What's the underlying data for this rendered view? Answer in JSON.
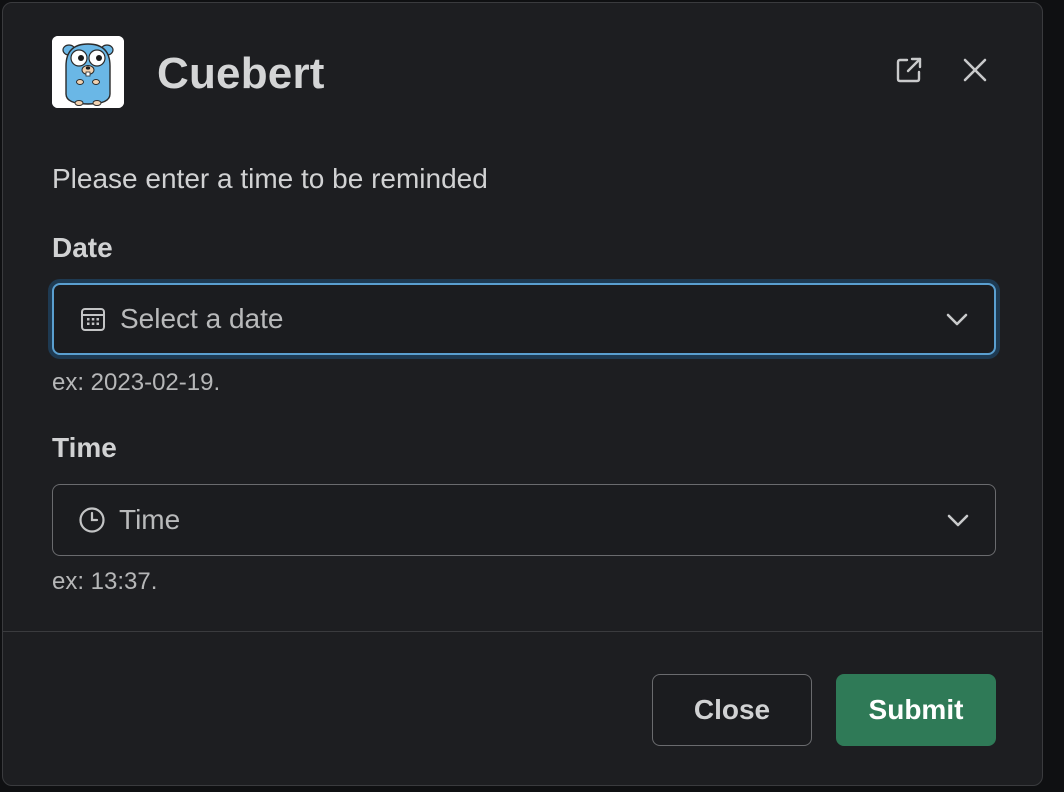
{
  "modal": {
    "title": "Cuebert",
    "app_icon": "gopher-mascot-icon",
    "header_actions": [
      {
        "icon": "open-in-new-window-icon"
      },
      {
        "icon": "close-icon"
      }
    ]
  },
  "form": {
    "prompt": "Please enter a time to be reminded",
    "date": {
      "label": "Date",
      "placeholder": "Select a date",
      "icon": "calendar-icon",
      "hint": "ex: 2023-02-19."
    },
    "time": {
      "label": "Time",
      "placeholder": "Time",
      "icon": "clock-icon",
      "hint": "ex: 13:37."
    }
  },
  "footer": {
    "close_label": "Close",
    "submit_label": "Submit"
  },
  "colors": {
    "background": "#1d1e21",
    "focus_border": "#5a9fd0",
    "submit": "#2f7a57"
  }
}
